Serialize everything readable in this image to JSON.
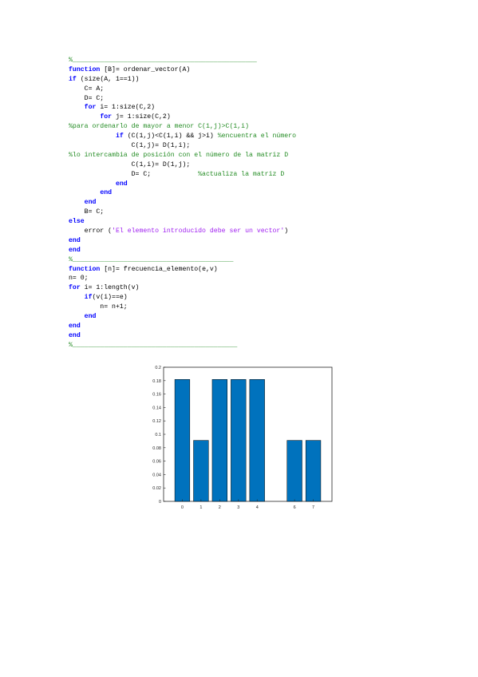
{
  "code": {
    "lines": [
      [
        {
          "t": "%_______________________________________________",
          "c": "cm"
        }
      ],
      [
        {
          "t": "function ",
          "c": "kw"
        },
        {
          "t": "[B]= ordenar_vector(A)",
          "c": "tx"
        }
      ],
      [
        {
          "t": "if ",
          "c": "kw"
        },
        {
          "t": "(size(A, 1==1))",
          "c": "tx"
        }
      ],
      [
        {
          "t": "    C= A;",
          "c": "tx"
        }
      ],
      [
        {
          "t": "    D= C;",
          "c": "tx"
        }
      ],
      [
        {
          "t": "    ",
          "c": "tx"
        },
        {
          "t": "for ",
          "c": "kw"
        },
        {
          "t": "i= 1:size(C,2)",
          "c": "tx"
        }
      ],
      [
        {
          "t": "        ",
          "c": "tx"
        },
        {
          "t": "for ",
          "c": "kw"
        },
        {
          "t": "j= 1:size(C,2)",
          "c": "tx"
        }
      ],
      [
        {
          "t": "%para ordenarlo de mayor a menor C(1,j)>C(1,i)",
          "c": "cm"
        }
      ],
      [
        {
          "t": "            ",
          "c": "tx"
        },
        {
          "t": "if ",
          "c": "kw"
        },
        {
          "t": "(C(1,j)<C(1,i) && j>i) ",
          "c": "tx"
        },
        {
          "t": "%encuentra el número",
          "c": "cm"
        }
      ],
      [
        {
          "t": "                C(1,j)= D(1,i);",
          "c": "tx"
        }
      ],
      [
        {
          "t": "%lo intercambia de posición con el número de la matriz D",
          "c": "cm"
        }
      ],
      [
        {
          "t": "                C(1,i)= D(1,j);",
          "c": "tx"
        }
      ],
      [
        {
          "t": "                D= C;            ",
          "c": "tx"
        },
        {
          "t": "%actualiza la matriz D",
          "c": "cm"
        }
      ],
      [
        {
          "t": "            ",
          "c": "tx"
        },
        {
          "t": "end",
          "c": "kw"
        }
      ],
      [
        {
          "t": "        ",
          "c": "tx"
        },
        {
          "t": "end",
          "c": "kw"
        }
      ],
      [
        {
          "t": "    ",
          "c": "tx"
        },
        {
          "t": "end",
          "c": "kw"
        }
      ],
      [
        {
          "t": "    B= C;",
          "c": "tx"
        }
      ],
      [
        {
          "t": "else",
          "c": "kw"
        }
      ],
      [
        {
          "t": "    error (",
          "c": "tx"
        },
        {
          "t": "'El elemento introducido debe ser un vector'",
          "c": "st"
        },
        {
          "t": ")",
          "c": "tx"
        }
      ],
      [
        {
          "t": "end",
          "c": "kw"
        }
      ],
      [
        {
          "t": "end",
          "c": "kw"
        }
      ],
      [
        {
          "t": "%_________________________________________",
          "c": "cm"
        }
      ],
      [
        {
          "t": "function ",
          "c": "kw"
        },
        {
          "t": "[n]= frecuencia_elemento(e,v)",
          "c": "tx"
        }
      ],
      [
        {
          "t": "n= 0;",
          "c": "tx"
        }
      ],
      [
        {
          "t": "for ",
          "c": "kw"
        },
        {
          "t": "i= 1:length(v)",
          "c": "tx"
        }
      ],
      [
        {
          "t": "    ",
          "c": "tx"
        },
        {
          "t": "if",
          "c": "kw"
        },
        {
          "t": "(v(i)==e)",
          "c": "tx"
        }
      ],
      [
        {
          "t": "        n= n+1;",
          "c": "tx"
        }
      ],
      [
        {
          "t": "    ",
          "c": "tx"
        },
        {
          "t": "end",
          "c": "kw"
        }
      ],
      [
        {
          "t": "end",
          "c": "kw"
        }
      ],
      [
        {
          "t": "end",
          "c": "kw"
        }
      ],
      [
        {
          "t": "%__________________________________________",
          "c": "cm"
        }
      ]
    ]
  },
  "colors": {
    "keyword": "#0000ff",
    "comment": "#228b22",
    "string": "#a020f0",
    "bar": "#0072bd"
  },
  "chart_data": {
    "type": "bar",
    "categories": [
      "0",
      "1",
      "2",
      "3",
      "4",
      "6",
      "7"
    ],
    "x": [
      0,
      1,
      2,
      3,
      4,
      6,
      7
    ],
    "values": [
      0.1818,
      0.0909,
      0.1818,
      0.1818,
      0.1818,
      0.0909,
      0.0909
    ],
    "xlim": [
      -1,
      8
    ],
    "ylim": [
      0,
      0.2
    ],
    "yticks": [
      "0",
      "0.02",
      "0.04",
      "0.06",
      "0.08",
      "0.1",
      "0.12",
      "0.14",
      "0.16",
      "0.18",
      "0.2"
    ],
    "xticks": [
      "0",
      "1",
      "2",
      "3",
      "4",
      "6",
      "7"
    ],
    "title": "",
    "xlabel": "",
    "ylabel": "",
    "grid": false
  }
}
